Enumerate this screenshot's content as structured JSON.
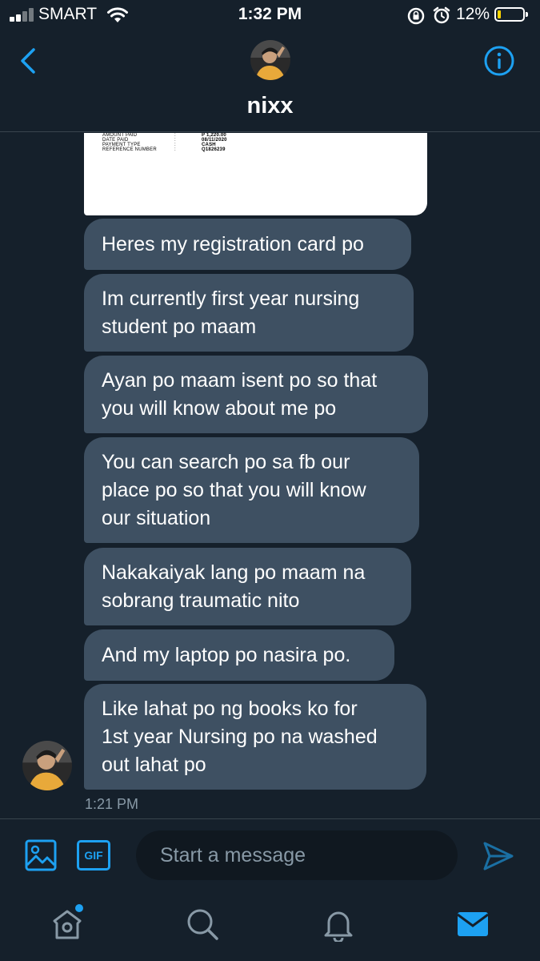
{
  "status_bar": {
    "carrier": "SMART",
    "time": "1:32 PM",
    "battery_percent": "12%",
    "battery_level": 0.12,
    "battery_color": "#ffd600"
  },
  "header": {
    "contact_name": "nixx",
    "back_icon": "chevron-left-icon",
    "info_icon": "info-icon"
  },
  "receipt": {
    "rows": [
      {
        "label": "AMOUNT PAID",
        "sep": ":",
        "value": "P 1,220.00"
      },
      {
        "label": "DATE PAID",
        "sep": ":",
        "value": "08/11/2020"
      },
      {
        "label": "PAYMENT TYPE",
        "sep": ":",
        "value": "CASH"
      },
      {
        "label": "REFERENCE NUMBER",
        "sep": ":",
        "value": "Q1826239"
      }
    ]
  },
  "messages": [
    {
      "text": "Heres my registration card po"
    },
    {
      "text": "Im currently first year nursing\nstudent po maam"
    },
    {
      "text": "Ayan po maam isent po so that\nyou will know about me po"
    },
    {
      "text": "You can search po sa fb our\nplace po so that you will know\nour situation"
    },
    {
      "text": "Nakakaiyak lang po maam na\nsobrang traumatic nito"
    },
    {
      "text": "And my laptop po nasira po."
    },
    {
      "text": "Like lahat po ng books ko for\n1st year Nursing po na washed\nout lahat po"
    }
  ],
  "message_time": "1:21 PM",
  "composer": {
    "placeholder": "Start a message",
    "gif_label": "GIF",
    "media_icon": "image-icon",
    "send_icon": "send-icon"
  },
  "nav": {
    "items": [
      "home-icon",
      "search-icon",
      "bell-icon",
      "mail-icon"
    ],
    "active": "mail-icon"
  },
  "colors": {
    "background": "#15202b",
    "bubble": "#3e5062",
    "accent": "#1da1f2",
    "muted": "#8899a6"
  }
}
